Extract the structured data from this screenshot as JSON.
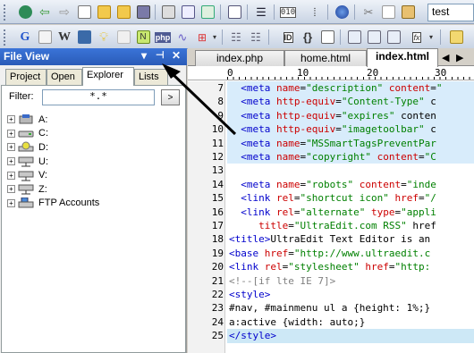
{
  "toolbar": {
    "find_value": "test",
    "row1_icons": [
      "back-icon",
      "forward-icon",
      "new-file-icon",
      "open-folder-icon",
      "close-file-icon",
      "save-icon",
      "print-icon",
      "print-preview-icon",
      "spell-check-icon",
      "document-icon",
      "wrap-icon",
      "hex-icon",
      "browser-icon",
      "cut-icon",
      "copy-icon",
      "paste-icon"
    ],
    "row2_icons": [
      "google-icon",
      "find-icon",
      "wikipedia-icon",
      "help-icon",
      "idea-icon",
      "notes-icon",
      "php-icon",
      "macro-icon",
      "tools-icon",
      "indent-icon",
      "id-icon",
      "brackets-icon",
      "column-icon",
      "compare-icon",
      "function-icon"
    ]
  },
  "file_view": {
    "title": "File View",
    "tabs": [
      "Project",
      "Open",
      "Explorer",
      "Lists"
    ],
    "active_tab": "Explorer",
    "filter_label": "Filter:",
    "filter_value": "*.*",
    "go_label": ">",
    "tree": [
      {
        "label": "A:"
      },
      {
        "label": "C:"
      },
      {
        "label": "D:"
      },
      {
        "label": "U:"
      },
      {
        "label": "V:"
      },
      {
        "label": "Z:"
      },
      {
        "label": "FTP Accounts"
      }
    ]
  },
  "editor": {
    "tabs": [
      "index.php",
      "home.html",
      "index.html"
    ],
    "active_tab": "index.html",
    "ruler": {
      "start": "0",
      "tick10": "10",
      "tick20": "20",
      "tick30": "30"
    },
    "lines": [
      {
        "n": "7",
        "text": "  <meta name=\"description\" content=\""
      },
      {
        "n": "8",
        "text": "  <meta http-equiv=\"Content-Type\" c"
      },
      {
        "n": "9",
        "text": "  <meta http-equiv=\"expires\" conten"
      },
      {
        "n": "10",
        "text": "  <meta http-equiv=\"imagetoolbar\" c"
      },
      {
        "n": "11",
        "text": "  <meta name=\"MSSmartTagsPreventPar"
      },
      {
        "n": "12",
        "text": "  <meta name=\"copyright\" content=\"C"
      },
      {
        "n": "13",
        "text": ""
      },
      {
        "n": "14",
        "text": "  <meta name=\"robots\" content=\"inde"
      },
      {
        "n": "15",
        "text": "  <link rel=\"shortcut icon\" href=\"/"
      },
      {
        "n": "16",
        "text": "  <link rel=\"alternate\" type=\"appli"
      },
      {
        "n": "17",
        "text": "     title=\"UltraEdit.com RSS\" href"
      },
      {
        "n": "18",
        "text": "<title>UltraEdit Text Editor is an"
      },
      {
        "n": "19",
        "text": "<base href=\"http://www.ultraedit.c"
      },
      {
        "n": "20",
        "text": "<link rel=\"stylesheet\" href=\"http:"
      },
      {
        "n": "21",
        "text": "<!--[if lte IE 7]>"
      },
      {
        "n": "22",
        "text": "<style>"
      },
      {
        "n": "23",
        "text": "#nav, #mainmenu ul a {height: 1%;}"
      },
      {
        "n": "24",
        "text": "a:active {width: auto;}"
      },
      {
        "n": "25",
        "text": "</style>"
      }
    ]
  },
  "colors": {
    "title_bar": "#2a5bb8",
    "tag": "#0000cc",
    "attr": "#cc0000",
    "string": "#008000",
    "comment": "#808080"
  }
}
